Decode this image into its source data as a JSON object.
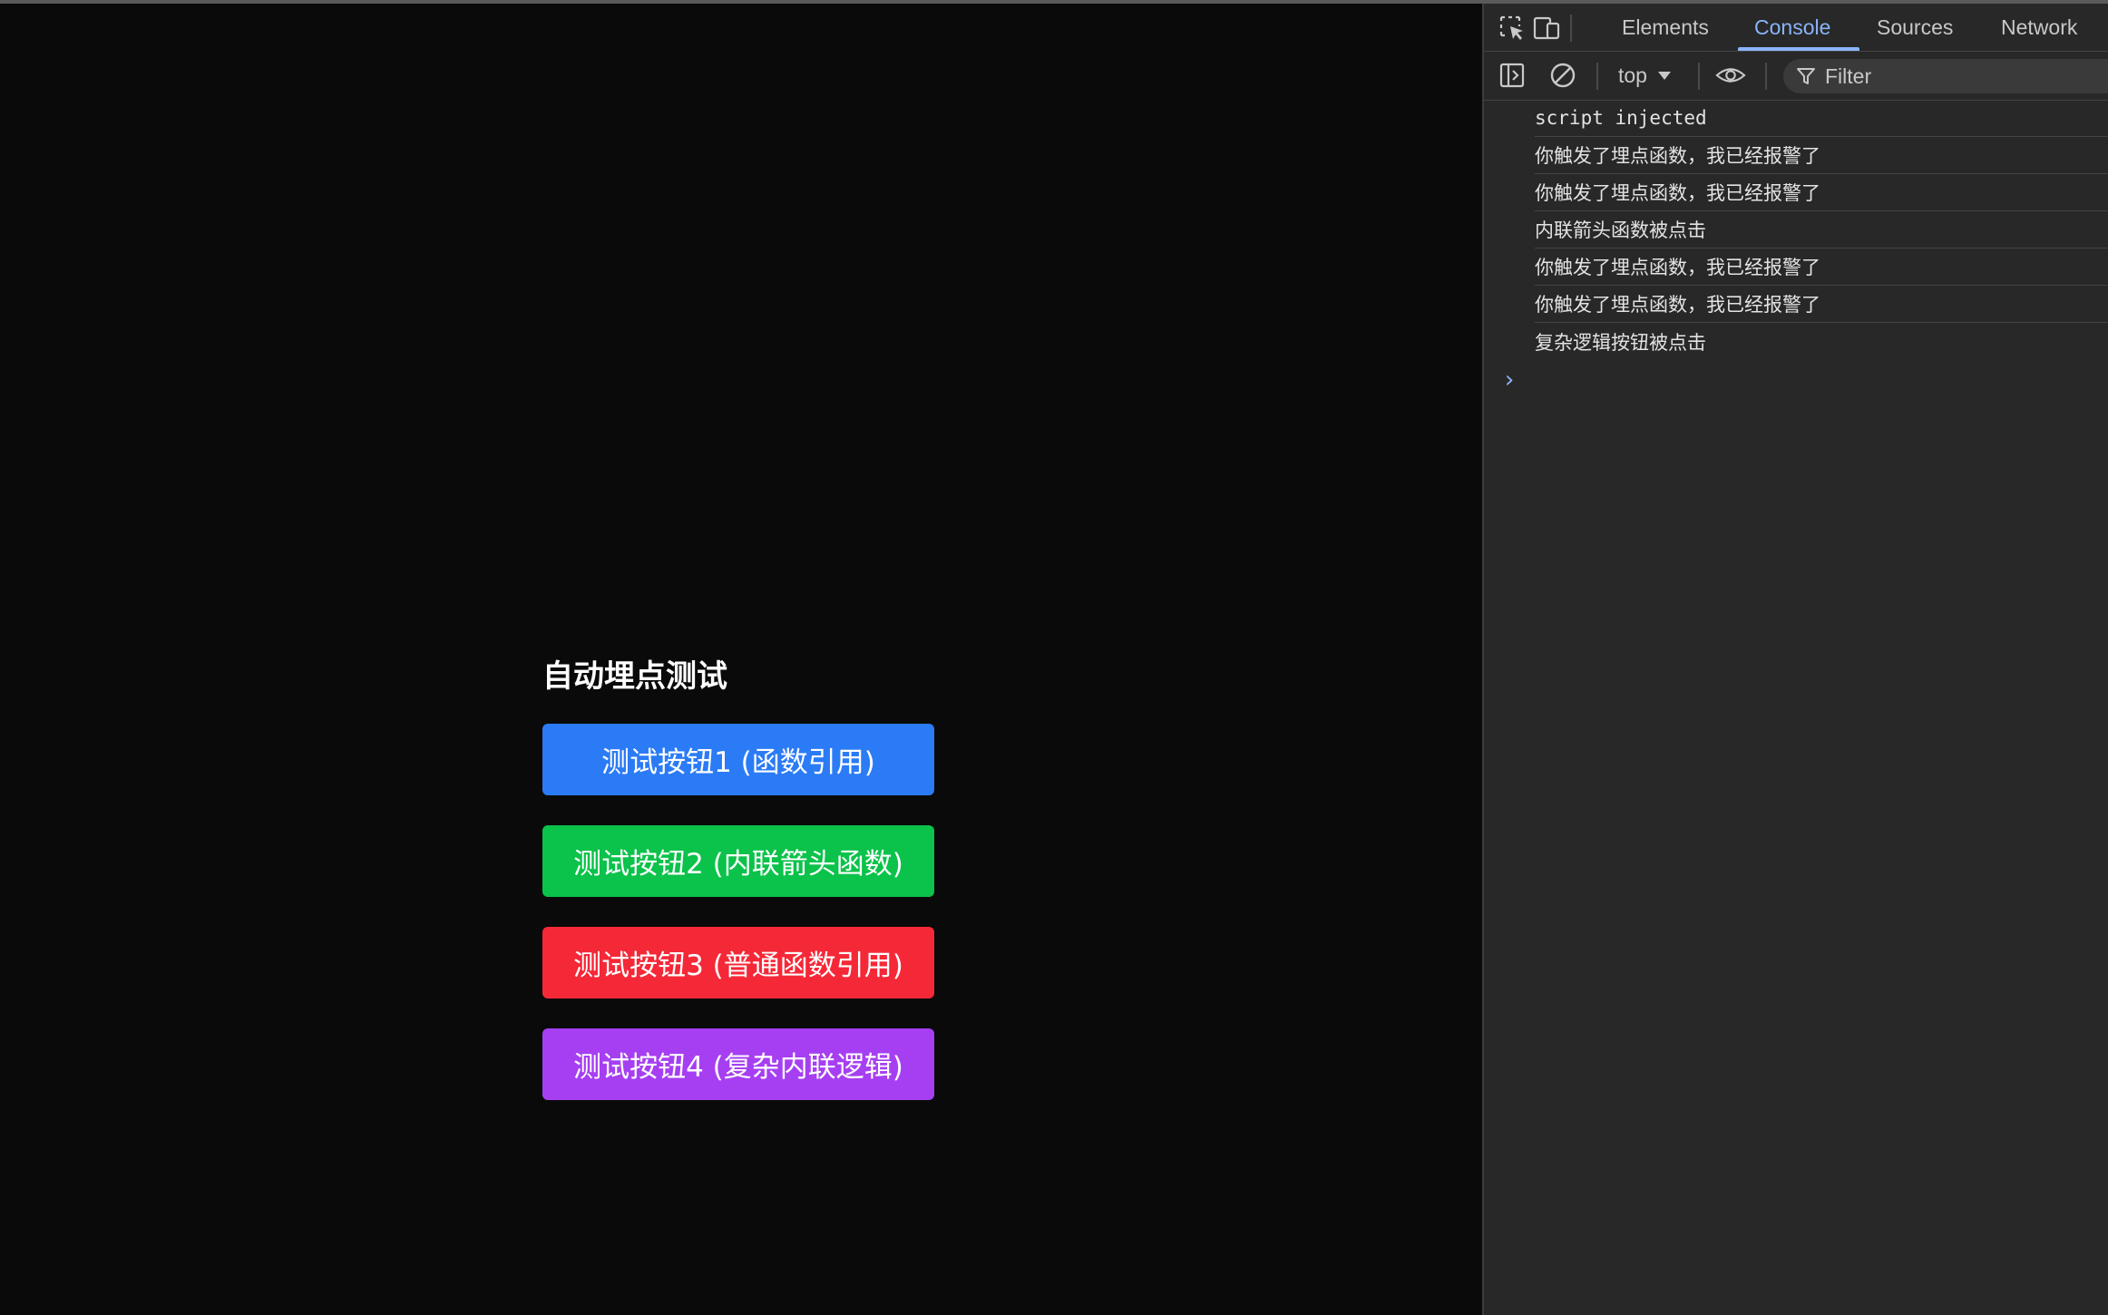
{
  "page": {
    "title": "自动埋点测试",
    "buttons": [
      {
        "label": "测试按钮1 (函数引用)",
        "color": "#2b7bf6"
      },
      {
        "label": "测试按钮2 (内联箭头函数)",
        "color": "#0bc24a"
      },
      {
        "label": "测试按钮3 (普通函数引用)",
        "color": "#f52838"
      },
      {
        "label": "测试按钮4 (复杂内联逻辑)",
        "color": "#a63ff2"
      }
    ]
  },
  "devtools": {
    "tabs": [
      {
        "label": "Elements",
        "active": false
      },
      {
        "label": "Console",
        "active": true
      },
      {
        "label": "Sources",
        "active": false
      },
      {
        "label": "Network",
        "active": false
      }
    ],
    "toolbar": {
      "context": "top",
      "filter_placeholder": "Filter"
    },
    "icons": {
      "inspect": "inspect-element-icon",
      "device": "device-toolbar-icon",
      "sidebar": "sidebar-toggle-icon",
      "clear": "clear-console-icon",
      "eye": "live-expression-eye-icon",
      "filter": "filter-funnel-icon",
      "prompt": "prompt-chevron-icon"
    },
    "accent": "#8ab4f8",
    "console_logs": [
      "script injected",
      "你触发了埋点函数，我已经报警了",
      "你触发了埋点函数，我已经报警了",
      "内联箭头函数被点击",
      "你触发了埋点函数，我已经报警了",
      "你触发了埋点函数，我已经报警了",
      "复杂逻辑按钮被点击"
    ],
    "prompt_symbol": "›"
  }
}
